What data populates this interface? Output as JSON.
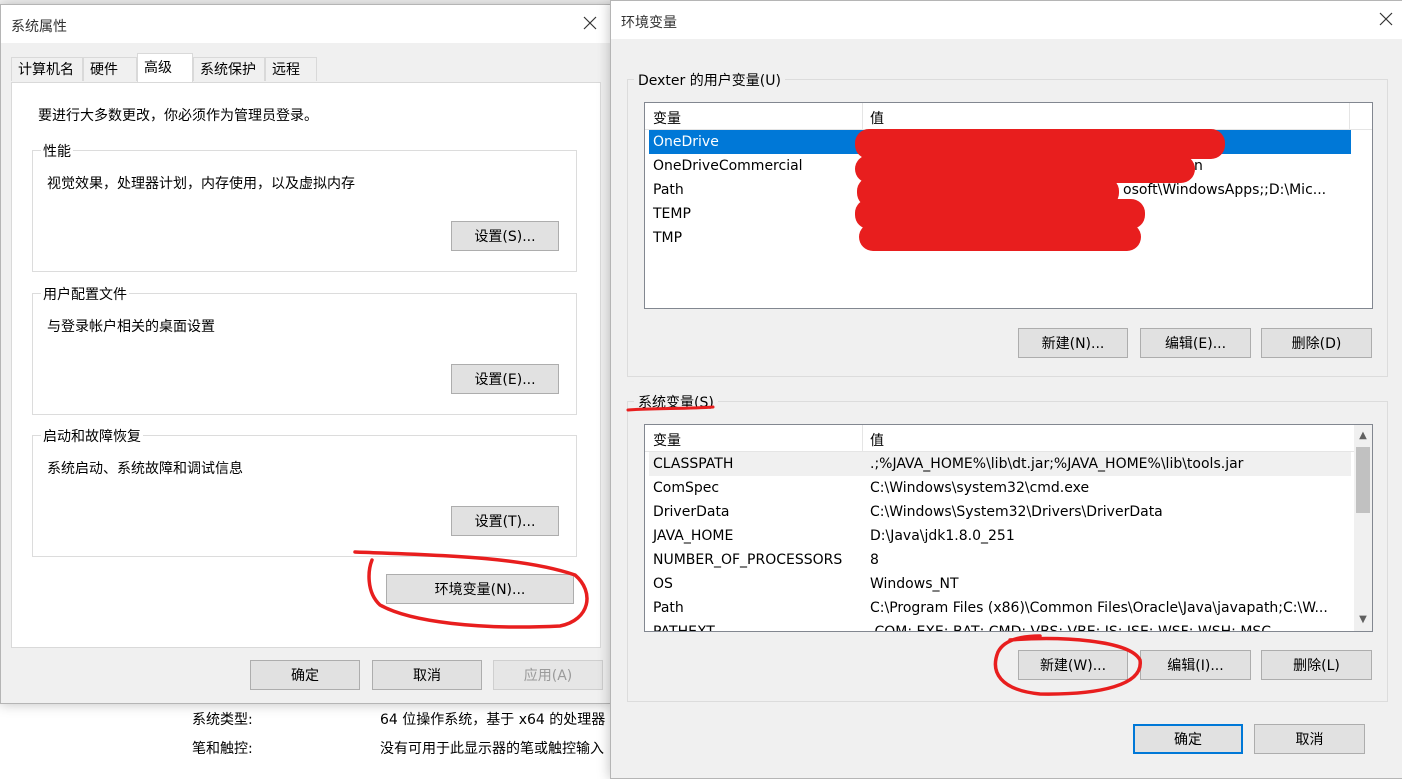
{
  "background": {
    "system_type_label": "系统类型:",
    "system_type_value": "64 位操作系统，基于 x64 的处理器",
    "pen_touch_label": "笔和触控:",
    "pen_touch_value": "没有可用于此显示器的笔或触控输入"
  },
  "system_properties": {
    "title": "系统属性",
    "tabs": [
      {
        "label": "计算机名"
      },
      {
        "label": "硬件"
      },
      {
        "label": "高级"
      },
      {
        "label": "系统保护"
      },
      {
        "label": "远程"
      }
    ],
    "active_tab": "高级",
    "admin_note": "要进行大多数更改，你必须作为管理员登录。",
    "groups": [
      {
        "legend": "性能",
        "description": "视觉效果，处理器计划，内存使用，以及虚拟内存",
        "button": "设置(S)..."
      },
      {
        "legend": "用户配置文件",
        "description": "与登录帐户相关的桌面设置",
        "button": "设置(E)..."
      },
      {
        "legend": "启动和故障恢复",
        "description": "系统启动、系统故障和调试信息",
        "button": "设置(T)..."
      }
    ],
    "env_button": "环境变量(N)...",
    "ok": "确定",
    "cancel": "取消",
    "apply": "应用(A)"
  },
  "environment_variables": {
    "title": "环境变量",
    "user_section": {
      "legend": "Dexter 的用户变量(U)",
      "columns": [
        "变量",
        "值"
      ],
      "rows": [
        {
          "name": "OneDrive",
          "value": "",
          "selected": true
        },
        {
          "name": "OneDriveCommercial",
          "value": "n"
        },
        {
          "name": "Path",
          "value": "osoft\\WindowsApps;;D:\\Mic..."
        },
        {
          "name": "TEMP",
          "value": ""
        },
        {
          "name": "TMP",
          "value": ""
        }
      ],
      "buttons": {
        "new": "新建(N)...",
        "edit": "编辑(E)...",
        "delete": "删除(D)"
      }
    },
    "system_section": {
      "legend": "系统变量(S)",
      "columns": [
        "变量",
        "值"
      ],
      "rows": [
        {
          "name": "CLASSPATH",
          "value": ".;%JAVA_HOME%\\lib\\dt.jar;%JAVA_HOME%\\lib\\tools.jar"
        },
        {
          "name": "ComSpec",
          "value": "C:\\Windows\\system32\\cmd.exe"
        },
        {
          "name": "DriverData",
          "value": "C:\\Windows\\System32\\Drivers\\DriverData"
        },
        {
          "name": "JAVA_HOME",
          "value": "D:\\Java\\jdk1.8.0_251"
        },
        {
          "name": "NUMBER_OF_PROCESSORS",
          "value": "8"
        },
        {
          "name": "OS",
          "value": "Windows_NT"
        },
        {
          "name": "Path",
          "value": "C:\\Program Files (x86)\\Common Files\\Oracle\\Java\\javapath;C:\\W..."
        },
        {
          "name": "PATHEXT",
          "value": ".COM;.EXE;.BAT;.CMD;.VBS;.VBE;.JS;.JSE;.WSF;.WSH;.MSC"
        }
      ],
      "buttons": {
        "new": "新建(W)...",
        "edit": "编辑(I)...",
        "delete": "删除(L)"
      }
    },
    "ok": "确定",
    "cancel": "取消"
  },
  "colors": {
    "selection": "#0078d7",
    "annotation_red": "#e81e1e",
    "dialog_bg": "#f0f0f0"
  }
}
